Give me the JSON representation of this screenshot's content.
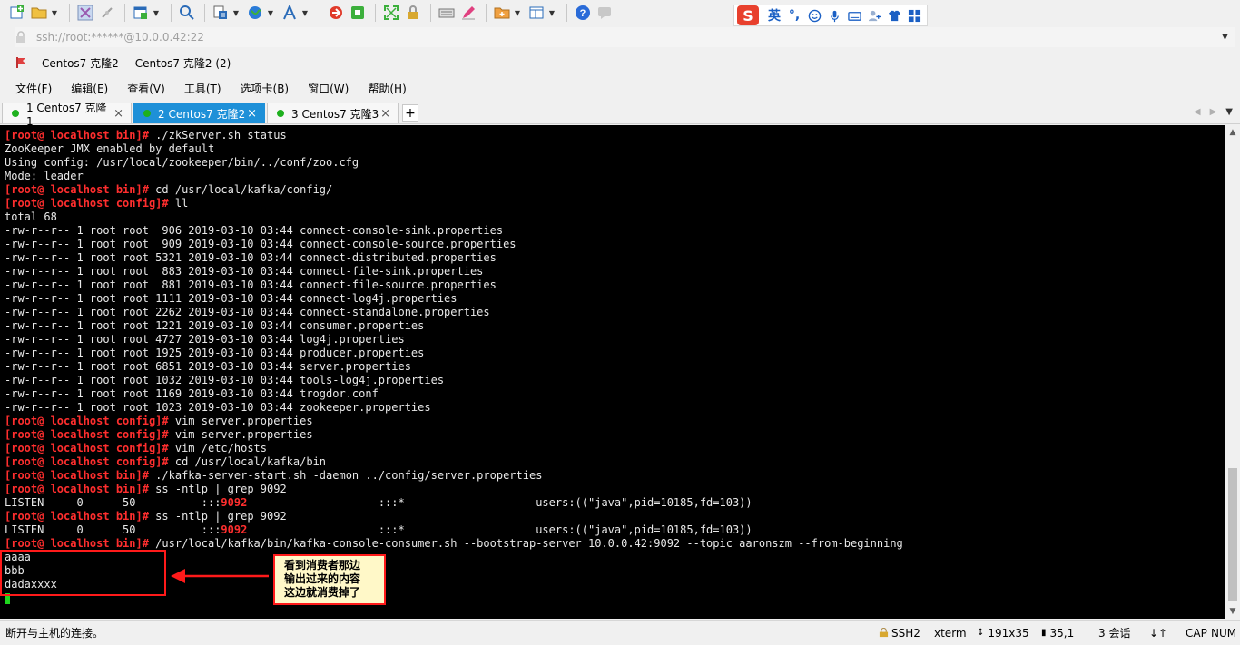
{
  "address_bar": {
    "url": "ssh://root:******@10.0.0.42:22"
  },
  "bookmarks": [
    "Centos7 克隆2",
    "Centos7 克隆2 (2)"
  ],
  "menu": [
    "文件(F)",
    "编辑(E)",
    "查看(V)",
    "工具(T)",
    "选项卡(B)",
    "窗口(W)",
    "帮助(H)"
  ],
  "ime": {
    "logo": "S",
    "lang": "英",
    "punct": "°,"
  },
  "tabs": [
    {
      "label": "1 Centos7 克隆1",
      "active": false
    },
    {
      "label": "2 Centos7 克隆2",
      "active": true
    },
    {
      "label": "3 Centos7 克隆3",
      "active": false
    }
  ],
  "terminal": {
    "lines": [
      {
        "prompt": "[root@ localhost bin]#",
        "text": " ./zkServer.sh status"
      },
      {
        "text": "ZooKeeper JMX enabled by default"
      },
      {
        "text": "Using config: /usr/local/zookeeper/bin/../conf/zoo.cfg"
      },
      {
        "text": "Mode: leader"
      },
      {
        "prompt": "[root@ localhost bin]#",
        "text": " cd /usr/local/kafka/config/"
      },
      {
        "prompt": "[root@ localhost config]#",
        "text": " ll"
      },
      {
        "text": "total 68"
      },
      {
        "text": "-rw-r--r-- 1 root root  906 2019-03-10 03:44 connect-console-sink.properties"
      },
      {
        "text": "-rw-r--r-- 1 root root  909 2019-03-10 03:44 connect-console-source.properties"
      },
      {
        "text": "-rw-r--r-- 1 root root 5321 2019-03-10 03:44 connect-distributed.properties"
      },
      {
        "text": "-rw-r--r-- 1 root root  883 2019-03-10 03:44 connect-file-sink.properties"
      },
      {
        "text": "-rw-r--r-- 1 root root  881 2019-03-10 03:44 connect-file-source.properties"
      },
      {
        "text": "-rw-r--r-- 1 root root 1111 2019-03-10 03:44 connect-log4j.properties"
      },
      {
        "text": "-rw-r--r-- 1 root root 2262 2019-03-10 03:44 connect-standalone.properties"
      },
      {
        "text": "-rw-r--r-- 1 root root 1221 2019-03-10 03:44 consumer.properties"
      },
      {
        "text": "-rw-r--r-- 1 root root 4727 2019-03-10 03:44 log4j.properties"
      },
      {
        "text": "-rw-r--r-- 1 root root 1925 2019-03-10 03:44 producer.properties"
      },
      {
        "text": "-rw-r--r-- 1 root root 6851 2019-03-10 03:44 server.properties"
      },
      {
        "text": "-rw-r--r-- 1 root root 1032 2019-03-10 03:44 tools-log4j.properties"
      },
      {
        "text": "-rw-r--r-- 1 root root 1169 2019-03-10 03:44 trogdor.conf"
      },
      {
        "text": "-rw-r--r-- 1 root root 1023 2019-03-10 03:44 zookeeper.properties"
      },
      {
        "prompt": "[root@ localhost config]#",
        "text": " vim server.properties"
      },
      {
        "prompt": "[root@ localhost config]#",
        "text": " vim server.properties"
      },
      {
        "prompt": "[root@ localhost config]#",
        "text": " vim /etc/hosts"
      },
      {
        "prompt": "[root@ localhost config]#",
        "text": " cd /usr/local/kafka/bin"
      },
      {
        "prompt": "[root@ localhost bin]#",
        "text": " ./kafka-server-start.sh -daemon ../config/server.properties"
      },
      {
        "prompt": "[root@ localhost bin]#",
        "text": " ss -ntlp | grep 9092"
      },
      {
        "text": "LISTEN     0      50          :::",
        "port": "9092",
        "after": "                    :::*                    users:((\"java\",pid=10185,fd=103))"
      },
      {
        "prompt": "[root@ localhost bin]#",
        "text": " ss -ntlp | grep 9092"
      },
      {
        "text": "LISTEN     0      50          :::",
        "port": "9092",
        "after": "                    :::*                    users:((\"java\",pid=10185,fd=103))"
      },
      {
        "prompt": "[root@ localhost bin]#",
        "text": " /usr/local/kafka/bin/kafka-console-consumer.sh --bootstrap-server 10.0.0.42:9092 --topic aaronszm --from-beginning"
      },
      {
        "text": "aaaa"
      },
      {
        "text": "bbb"
      },
      {
        "text": "dadaxxxx"
      }
    ]
  },
  "annotation": {
    "lines": [
      "看到消费者那边",
      "输出过来的内容",
      "这边就消费掉了"
    ]
  },
  "status": {
    "message": "断开与主机的连接。",
    "protocol": "SSH2",
    "term": "xterm",
    "size": "191x35",
    "pos": "35,1",
    "sessions": "3 会话",
    "caps": "CAP",
    "num": "NUM"
  },
  "colors": {
    "prompt": "#ff2e2e",
    "tab_active": "#1e90d8",
    "annotation_border": "#ff1a1a",
    "cursor": "#1ed81e"
  }
}
